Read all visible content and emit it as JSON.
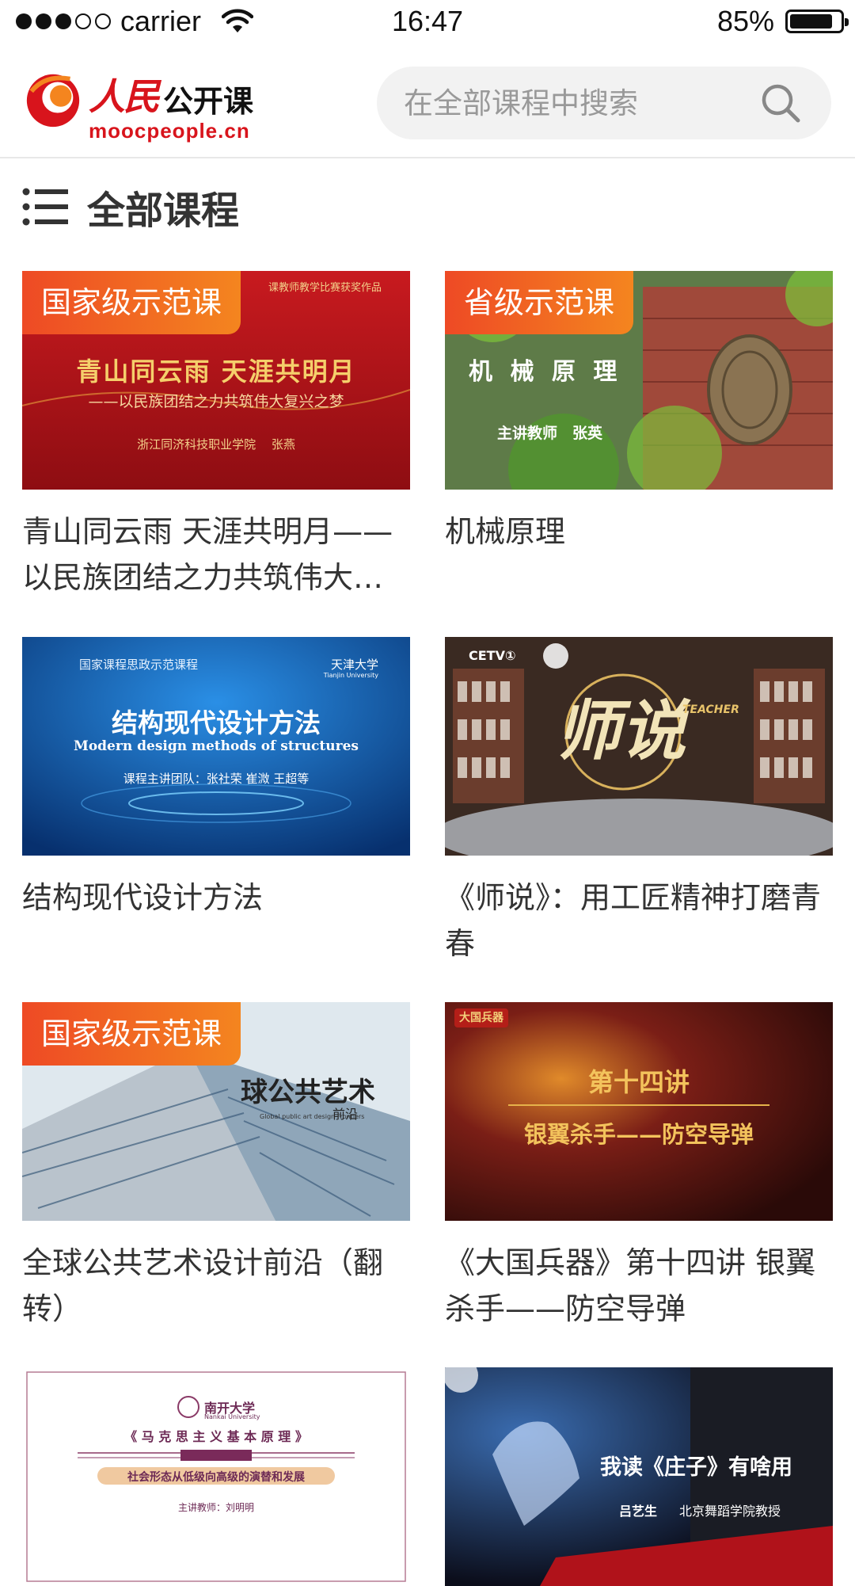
{
  "status_bar": {
    "carrier": "carrier",
    "time": "16:47",
    "battery": "85%",
    "battery_level": 0.85
  },
  "header": {
    "logo_cn_red": "人民",
    "logo_cn_black": "公开课",
    "logo_en": "moocpeople.cn",
    "search_placeholder": "在全部课程中搜索"
  },
  "section": {
    "title": "全部课程"
  },
  "courses": [
    {
      "title": "青山同云雨 天涯共明月——以民族团结之力共筑伟大复兴之梦",
      "badge": "国家级示范课",
      "thumb_text": {
        "top": "课教师教学比赛获奖作品",
        "main": "青山同云雨 天涯共明月",
        "sub": "——以民族团结之力共筑伟大复兴之梦",
        "foot": "浙江同济科技职业学院　 张燕"
      }
    },
    {
      "title": "机械原理",
      "badge": "省级示范课",
      "thumb_text": {
        "main": "机 械 原 理",
        "sub": "主讲教师　张英"
      }
    },
    {
      "title": "结构现代设计方法",
      "badge": "",
      "thumb_text": {
        "top": "国家课程思政示范课程",
        "uni": "天津大学",
        "uni_en": "Tianjin University",
        "main": "结构现代设计方法",
        "sub": "Modern design methods of structures",
        "foot": "课程主讲团队：张社荣 崔溦 王超等"
      }
    },
    {
      "title": "《师说》：用工匠精神打磨青春",
      "badge": "",
      "thumb_text": {
        "logo": "CETV①",
        "main": "师说",
        "sub": "TEACHER"
      }
    },
    {
      "title": "全球公共艺术设计前沿（翻转）",
      "badge": "国家级示范课",
      "thumb_text": {
        "main": "球公共艺术",
        "sub": "前沿",
        "en": "Global public art design Frontiers"
      }
    },
    {
      "title": "《大国兵器》第十四讲 银翼杀手——防空导弹",
      "badge": "",
      "thumb_text": {
        "logo": "大国兵器",
        "main": "第十四讲",
        "sub": "银翼杀手——防空导弹"
      }
    },
    {
      "title": "",
      "badge": "",
      "thumb_text": {
        "uni": "南开大学",
        "uni_en": "Nankai University",
        "main": "《 马 克 思 主 义 基 本 原 理 》",
        "sub": "社会形态从低级向高级的演替和发展",
        "foot": "主讲教师：刘明明"
      }
    },
    {
      "title": "",
      "badge": "",
      "thumb_text": {
        "main": "我读《庄子》有啥用",
        "foot_name": "吕艺生",
        "foot": "北京舞蹈学院教授"
      }
    }
  ],
  "colors": {
    "brand_red": "#d8141c",
    "badge_start": "#ee4a25",
    "badge_end": "#f4851f"
  }
}
